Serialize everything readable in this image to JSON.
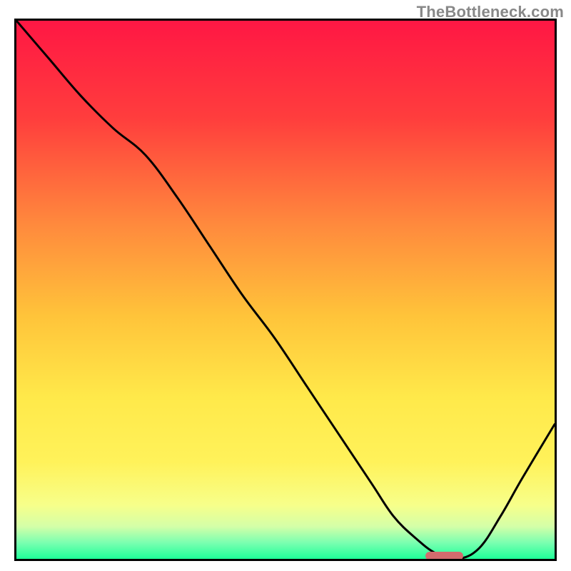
{
  "watermark": "TheBottleneck.com",
  "chart_data": {
    "type": "line",
    "title": "",
    "xlabel": "",
    "ylabel": "",
    "xlim": [
      0,
      100
    ],
    "ylim": [
      0,
      100
    ],
    "grid": false,
    "legend": false,
    "background_gradient": {
      "stops": [
        {
          "pos": 0.0,
          "color": "#ff1744"
        },
        {
          "pos": 0.18,
          "color": "#ff3d3d"
        },
        {
          "pos": 0.38,
          "color": "#ff8a3d"
        },
        {
          "pos": 0.55,
          "color": "#ffc43a"
        },
        {
          "pos": 0.7,
          "color": "#ffe94a"
        },
        {
          "pos": 0.82,
          "color": "#fff25a"
        },
        {
          "pos": 0.9,
          "color": "#f7ff8a"
        },
        {
          "pos": 0.94,
          "color": "#d4ffa8"
        },
        {
          "pos": 0.97,
          "color": "#7affb0"
        },
        {
          "pos": 1.0,
          "color": "#1fff99"
        }
      ]
    },
    "series": [
      {
        "name": "bottleneck-curve",
        "color": "#000000",
        "x": [
          0,
          6,
          12,
          18,
          24,
          30,
          36,
          42,
          48,
          54,
          60,
          66,
          70,
          74,
          78,
          82,
          86,
          90,
          94,
          100
        ],
        "y": [
          100,
          93,
          86,
          80,
          75,
          67,
          58,
          49,
          41,
          32,
          23,
          14,
          8,
          4,
          1,
          0,
          2,
          8,
          15,
          25
        ]
      }
    ],
    "marker": {
      "name": "optimal-range",
      "color": "#d36b6e",
      "x_start": 76,
      "x_end": 83,
      "y": 0.5,
      "height": 1.6
    }
  }
}
